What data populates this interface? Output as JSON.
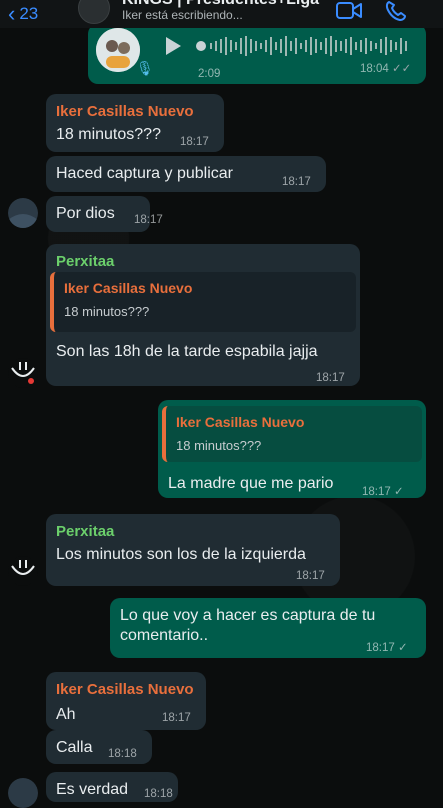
{
  "header": {
    "back_count": "23",
    "title": "KINGS | Presidentes+Liga",
    "subtitle": "Iker está escribiendo..."
  },
  "voice_note": {
    "duration": "2:09",
    "time": "18:04"
  },
  "messages": [
    {
      "sender": "Iker Casillas Nuevo",
      "text": "18 minutos???",
      "time": "18:17"
    },
    {
      "text": "Haced captura y publicar",
      "time": "18:17"
    },
    {
      "text": "Por dios",
      "time": "18:17"
    },
    {
      "sender": "Perxitaa",
      "quote_sender": "Iker Casillas Nuevo",
      "quote_text": "18 minutos???",
      "text": "Son las 18h de la tarde espabila jajja",
      "time": "18:17"
    },
    {
      "quote_sender": "Iker Casillas Nuevo",
      "quote_text": "18 minutos???",
      "text": "La madre que me pario",
      "time": "18:17"
    },
    {
      "sender": "Perxitaa",
      "text": "Los minutos son los de la izquierda",
      "time": "18:17"
    },
    {
      "text_line1": "Lo que voy a hacer es captura de tu",
      "text_line2": "comentario..",
      "time": "18:17"
    },
    {
      "sender": "Iker Casillas Nuevo",
      "text": "Ah",
      "time": "18:17"
    },
    {
      "text": "Calla",
      "time": "18:18"
    },
    {
      "text": "Es verdad",
      "time": "18:18"
    }
  ],
  "colors": {
    "incoming": "#202c33",
    "outgoing": "#005c4b",
    "accent": "#3a8cff",
    "sender_orange": "#e86f3c",
    "sender_green": "#6bcf6b"
  }
}
